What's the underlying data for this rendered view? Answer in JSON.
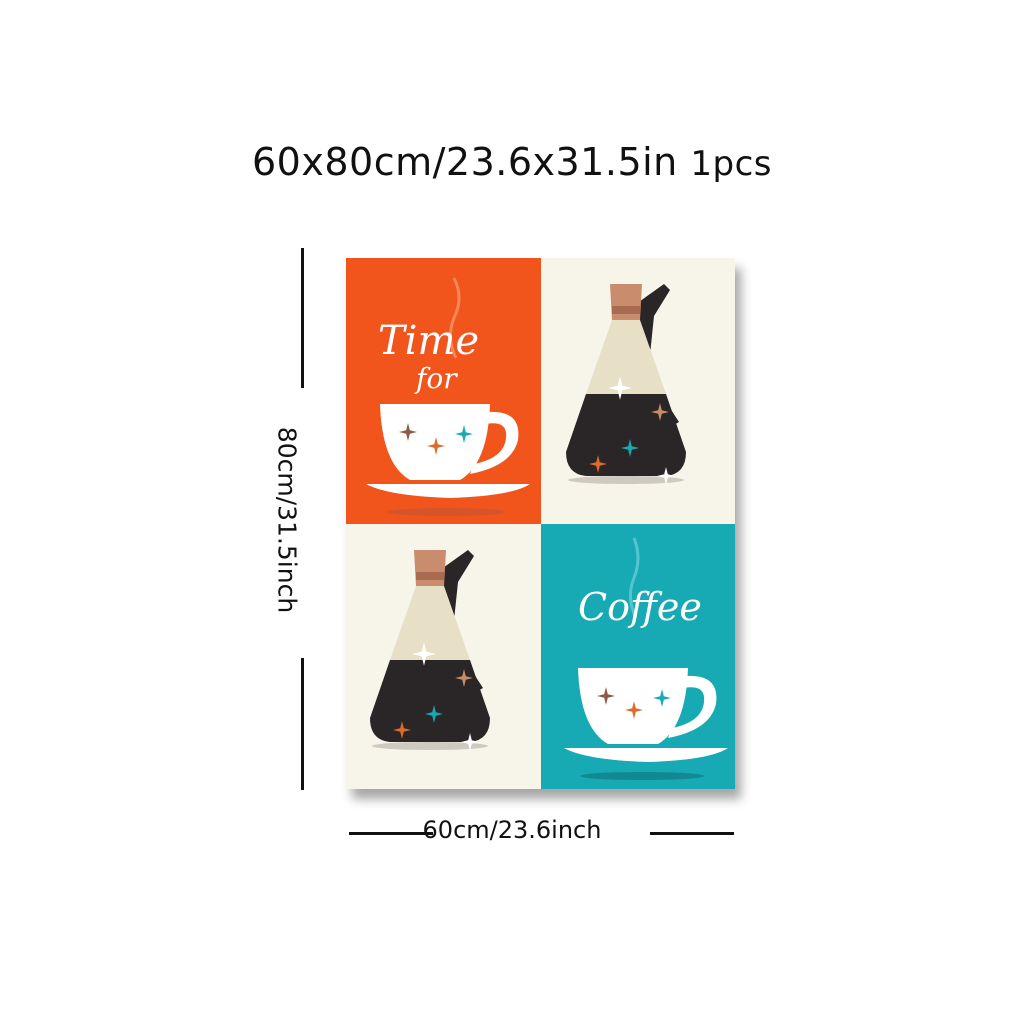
{
  "product": {
    "size_label": "60x80cm/23.6x31.5in",
    "quantity_label": "1pcs",
    "width_label": "60cm/23.6inch",
    "height_label": "80cm/31.5inch"
  },
  "artwork": {
    "panel_top_left_text_line1": "Time",
    "panel_top_left_text_line2": "for",
    "panel_bottom_right_text": "Coffee",
    "colors": {
      "orange": "#f2551c",
      "teal": "#17a9b4",
      "cream": "#f7f4ea",
      "dark": "#2a2526",
      "copper": "#c98c6d"
    },
    "icons": [
      "coffee-cup-icon",
      "coffee-carafe-icon",
      "starburst-icon"
    ]
  }
}
